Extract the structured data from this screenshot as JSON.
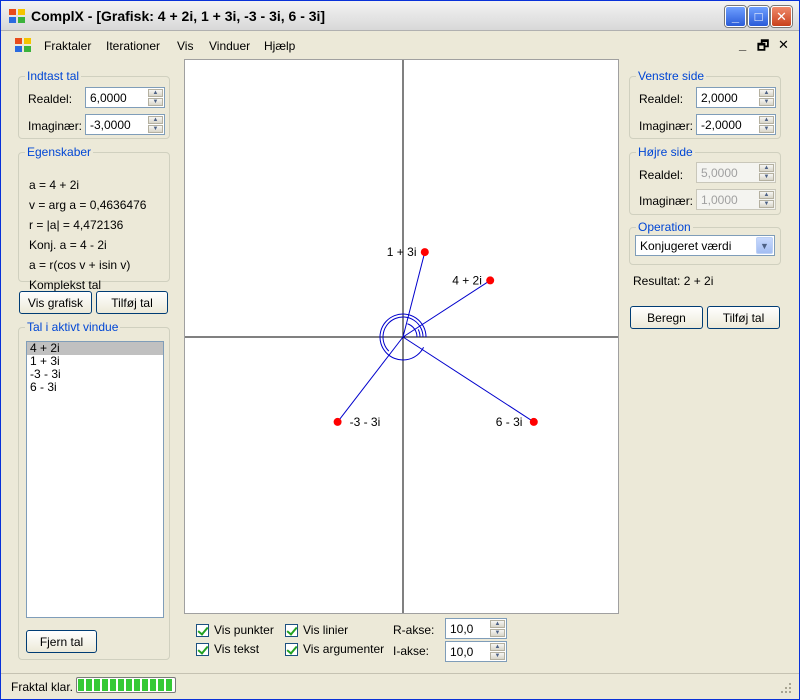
{
  "window": {
    "title": "ComplX - [Grafisk: 4 + 2i, 1 + 3i, -3 - 3i, 6 - 3i]"
  },
  "menu": {
    "items": [
      "Fraktaler",
      "Iterationer",
      "Vis",
      "Vinduer",
      "Hjælp"
    ],
    "mdi_minimize": "_",
    "mdi_restore": "🗗",
    "mdi_close": "✕"
  },
  "left": {
    "input_group": {
      "legend": "Indtast tal",
      "real_label": "Realdel:",
      "real_value": "6,0000",
      "imag_label": "Imaginær:",
      "imag_value": "-3,0000"
    },
    "props_group": {
      "legend": "Egenskaber",
      "rows": [
        "a = 4 + 2i",
        "v = arg a = 0,4636476",
        "r = |a| = 4,472136",
        "Konj. a = 4 - 2i",
        "a = r(cos v + isin v)",
        "Komplekst tal"
      ]
    },
    "buttons": {
      "show_graph": "Vis grafisk",
      "add_number": "Tilføj tal"
    },
    "list_group": {
      "legend": "Tal i aktivt vindue",
      "items": [
        "4 + 2i",
        "1 + 3i",
        "-3 - 3i",
        "6 - 3i"
      ],
      "selected_index": 0,
      "remove_button": "Fjern tal"
    }
  },
  "plot": {
    "points": [
      {
        "label": "1 + 3i",
        "re": 1,
        "im": 3
      },
      {
        "label": "4 + 2i",
        "re": 4,
        "im": 2
      },
      {
        "label": "-3 - 3i",
        "re": -3,
        "im": -3
      },
      {
        "label": "6 - 3i",
        "re": 6,
        "im": -3
      }
    ],
    "point_color": "#ff0000",
    "line_color": "#0000cc",
    "r_axis_max": 10,
    "i_axis_max": 10
  },
  "bottom": {
    "checkboxes": [
      {
        "label": "Vis punkter",
        "checked": true
      },
      {
        "label": "Vis linier",
        "checked": true
      },
      {
        "label": "Vis tekst",
        "checked": true
      },
      {
        "label": "Vis argumenter",
        "checked": true
      }
    ],
    "r_axis_label": "R-akse:",
    "r_axis_value": "10,0",
    "i_axis_label": "I-akse:",
    "i_axis_value": "10,0"
  },
  "right": {
    "left_side": {
      "legend": "Venstre side",
      "real_label": "Realdel:",
      "real_value": "2,0000",
      "imag_label": "Imaginær:",
      "imag_value": "-2,0000"
    },
    "right_side": {
      "legend": "Højre side",
      "real_label": "Realdel:",
      "real_value": "5,0000",
      "imag_label": "Imaginær:",
      "imag_value": "1,0000"
    },
    "operation": {
      "legend": "Operation",
      "selected": "Konjugeret værdi"
    },
    "result": "Resultat: 2 + 2i",
    "calc_button": "Beregn",
    "add_button": "Tilføj tal"
  },
  "status": {
    "text": "Fraktal klar.",
    "progress_segments": 12
  }
}
